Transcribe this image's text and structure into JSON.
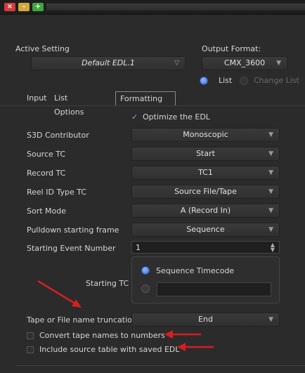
{
  "window": {
    "close_glyph": "×",
    "minimize_glyph": "–",
    "maximize_glyph": "+"
  },
  "header": {
    "active_setting_label": "Active Setting",
    "active_setting_value": "Default EDL.1",
    "output_format_label": "Output Format:",
    "output_format_value": "CMX_3600",
    "list_label": "List",
    "change_list_label": "Change List"
  },
  "tabs": [
    {
      "label": "Input",
      "active": false
    },
    {
      "label": "List Options",
      "active": false
    },
    {
      "label": "Formatting",
      "active": true
    }
  ],
  "formatting": {
    "optimize_check": "✓",
    "optimize_label": "Optimize the EDL",
    "rows": [
      {
        "label": "S3D Contributor",
        "value": "Monoscopic"
      },
      {
        "label": "Source TC",
        "value": "Start"
      },
      {
        "label": "Record TC",
        "value": "TC1"
      },
      {
        "label": "Reel ID Type TC",
        "value": "Source File/Tape"
      },
      {
        "label": "Sort Mode",
        "value": "A (Record In)"
      },
      {
        "label": "Pulldown starting frame",
        "value": "Sequence"
      }
    ],
    "starting_event_label": "Starting Event Number",
    "starting_event_value": "1",
    "starting_tc_label": "Starting TC",
    "sequence_timecode_label": "Sequence Timecode",
    "truncation_label": "Tape or File name truncation",
    "truncation_value": "End",
    "convert_tape_label": "Convert tape names to numbers",
    "include_source_label": "Include source table with saved EDL"
  },
  "colors": {
    "annotation_arrow": "#d61f1f",
    "radio_selected": "#3c6fd6"
  }
}
